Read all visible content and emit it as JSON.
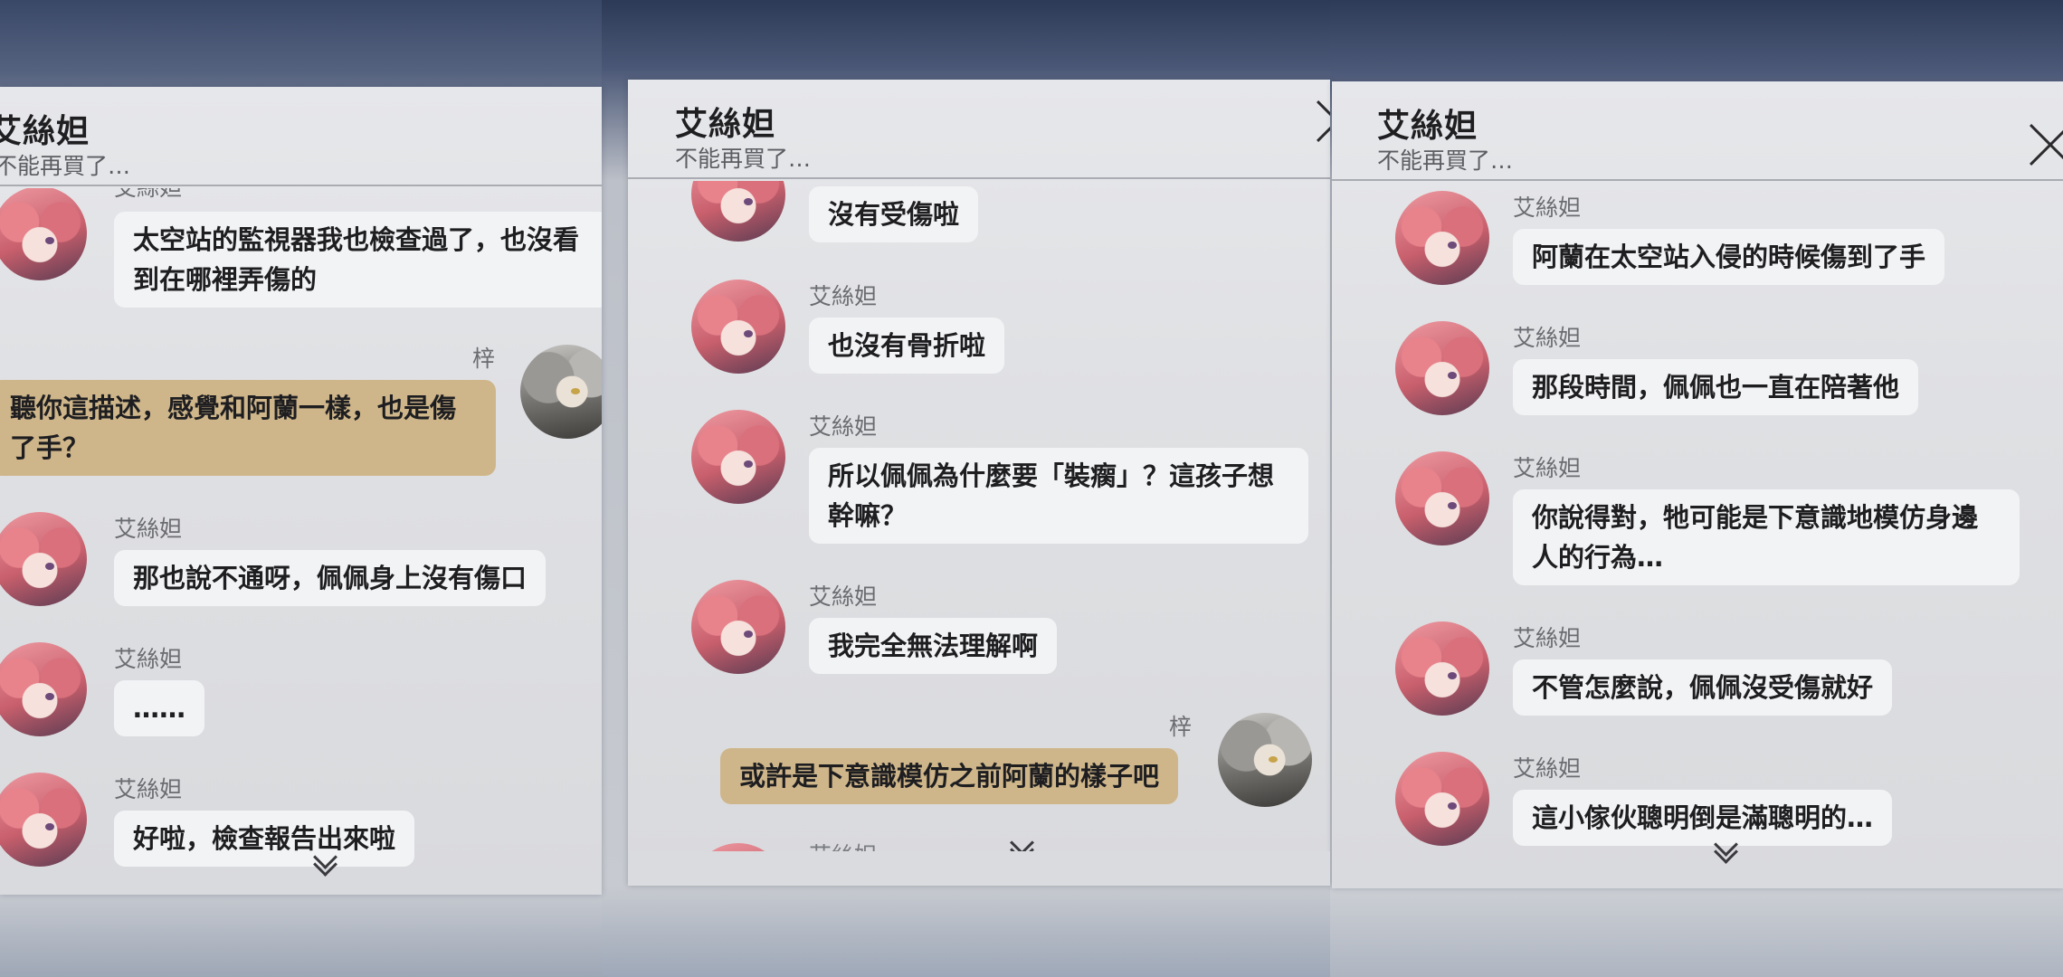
{
  "panels": [
    {
      "title": "艾絲妲",
      "subtitle": "不能再買了…",
      "messages": [
        {
          "sender": "艾絲妲",
          "text": "太空站的監視器我也檢查過了，也沒看到在哪裡弄傷的"
        },
        {
          "sender": "梓",
          "text": "聽你這描述，感覺和阿蘭一樣，也是傷了手？"
        },
        {
          "sender": "艾絲妲",
          "text": "那也說不通呀，佩佩身上沒有傷口"
        },
        {
          "sender": "艾絲妲",
          "text": "……"
        },
        {
          "sender": "艾絲妲",
          "text": "好啦，檢查報告出來啦"
        }
      ]
    },
    {
      "title": "艾絲妲",
      "subtitle": "不能再買了…",
      "messages": [
        {
          "sender": "",
          "text": "沒有受傷啦"
        },
        {
          "sender": "艾絲妲",
          "text": "也沒有骨折啦"
        },
        {
          "sender": "艾絲妲",
          "text": "所以佩佩為什麼要「裝瘸」？這孩子想幹嘛？"
        },
        {
          "sender": "艾絲妲",
          "text": "我完全無法理解啊"
        },
        {
          "sender": "梓",
          "text": "或許是下意識模仿之前阿蘭的樣子吧"
        },
        {
          "sender": "艾絲妲",
          "text": ""
        }
      ]
    },
    {
      "title": "艾絲妲",
      "subtitle": "不能再買了…",
      "messages": [
        {
          "sender": "艾絲妲",
          "text": "阿蘭在太空站入侵的時候傷到了手"
        },
        {
          "sender": "艾絲妲",
          "text": "那段時間，佩佩也一直在陪著他"
        },
        {
          "sender": "艾絲妲",
          "text": "你說得對，牠可能是下意識地模仿身邊人的行為…"
        },
        {
          "sender": "艾絲妲",
          "text": "不管怎麼說，佩佩沒受傷就好"
        },
        {
          "sender": "艾絲妲",
          "text": "這小傢伙聰明倒是滿聰明的…"
        }
      ]
    }
  ],
  "colors": {
    "my_bubble": "#cfb68a",
    "other_bubble": "#f2f3f5"
  }
}
